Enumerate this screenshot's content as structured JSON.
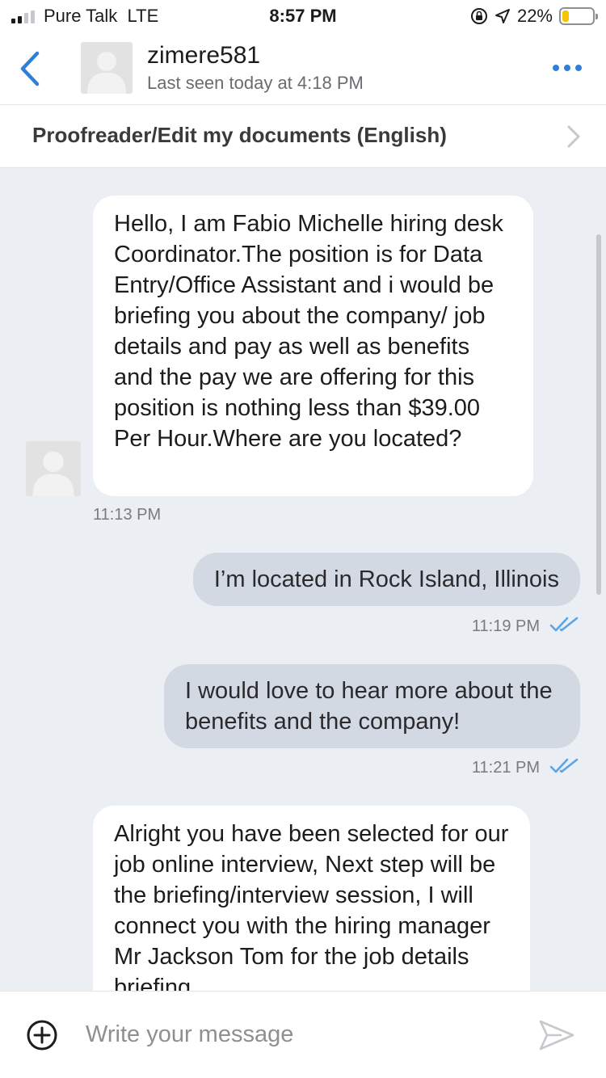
{
  "status_bar": {
    "carrier": "Pure Talk",
    "network": "LTE",
    "time": "8:57 PM",
    "battery": "22%",
    "battery_level": 0.22
  },
  "header": {
    "contact_name": "zimere581",
    "last_seen": "Last seen today at 4:18 PM"
  },
  "job": {
    "title": "Proofreader/Edit my documents (English)"
  },
  "messages": [
    {
      "direction": "incoming",
      "text": "Hello, I am Fabio Michelle  hiring desk Coordinator.The position is for Data Entry/Office Assistant and i would be briefing you about the company/ job details and pay as well as benefits and the pay we are offering for this position is nothing less than $39.00 Per Hour.Where are you located?",
      "time": "11:13 PM"
    },
    {
      "direction": "outgoing",
      "text": "I’m located in Rock Island, Illinois",
      "time": "11:19 PM",
      "read": true
    },
    {
      "direction": "outgoing",
      "text": "I would love to hear more about the benefits and the company!",
      "time": "11:21 PM",
      "read": true
    },
    {
      "direction": "incoming",
      "text": "Alright you have been selected for our job online interview, Next step will be the briefing/interview session, I will connect you with the hiring manager Mr Jackson Tom for the job details briefing"
    }
  ],
  "composer": {
    "placeholder": "Write your message"
  },
  "colors": {
    "accent": "#2f7fd6",
    "read_check": "#5aa4e8",
    "outgoing_bubble": "#d3d9e2",
    "conversation_bg": "#ebeef3"
  }
}
